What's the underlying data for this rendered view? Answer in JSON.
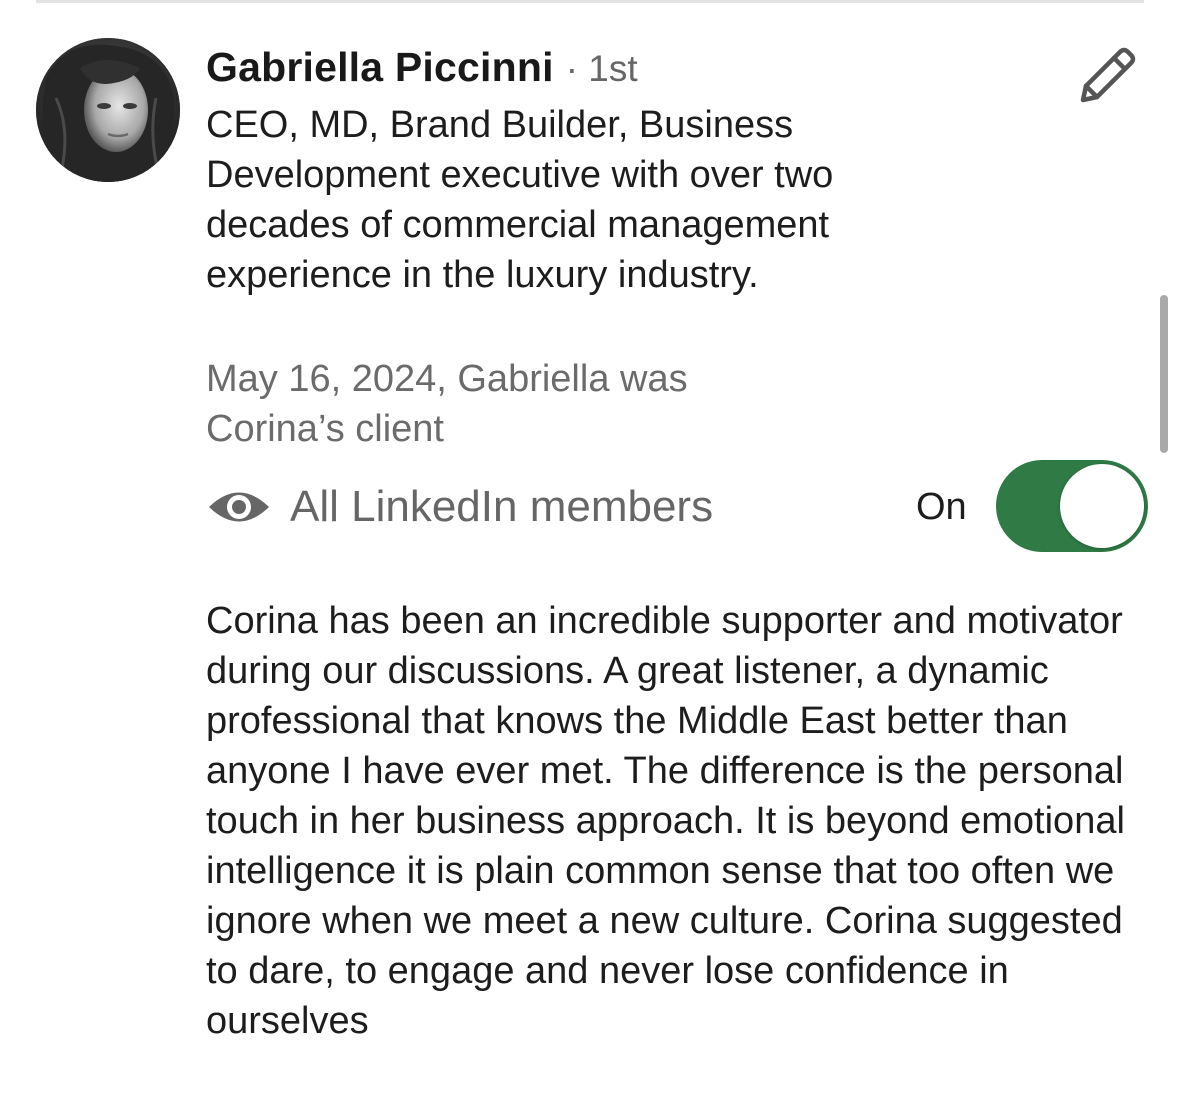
{
  "recommendation": {
    "author_name": "Gabriella Piccinni",
    "connection_degree": "· 1st",
    "headline": "CEO, MD, Brand Builder, Business Development executive with over two decades of commercial management experience in the luxury industry.",
    "relationship": "May 16, 2024, Gabriella was Corina’s client",
    "visibility": {
      "icon": "eye-icon",
      "label": "All LinkedIn members",
      "toggle_label": "On",
      "toggle_on": true,
      "toggle_color": "#2f7a45"
    },
    "text": "Corina has been an incredible supporter and motivator during our discussions. A great listener, a dynamic professional that knows the Middle East better than anyone I have ever met. The difference is the personal touch in her business approach. It is beyond emotional intelligence it is plain common sense that too often we ignore when we meet a new culture. Corina suggested to dare, to engage and never lose confidence in ourselves",
    "edit_icon": "pencil-icon"
  }
}
